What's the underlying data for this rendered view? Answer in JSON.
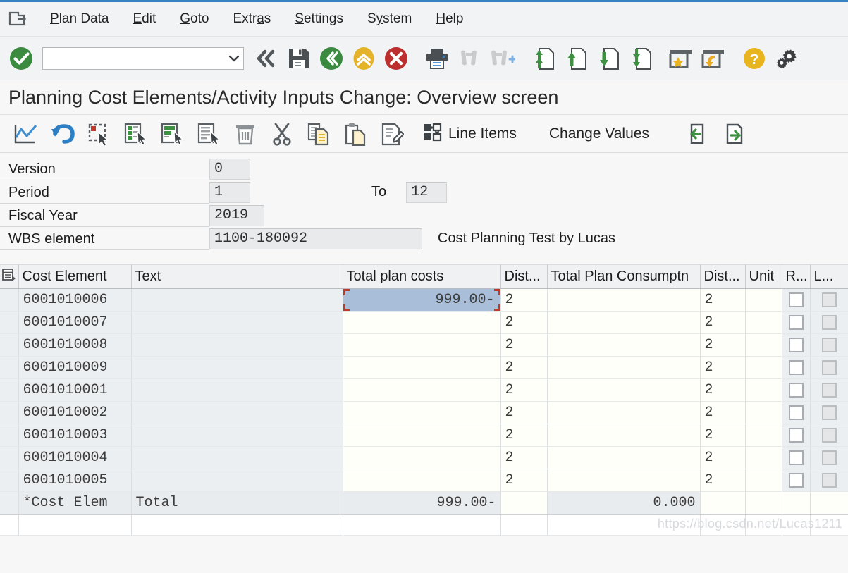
{
  "window": {
    "title": "Planning Cost Elements/Activity Inputs Change: Overview screen"
  },
  "menubar": {
    "system_icon": "sap-session-icon",
    "items": [
      {
        "label": "Plan Data",
        "accel": "P"
      },
      {
        "label": "Edit",
        "accel": "E"
      },
      {
        "label": "Goto",
        "accel": "G"
      },
      {
        "label": "Extras",
        "accel": "a"
      },
      {
        "label": "Settings",
        "accel": "S"
      },
      {
        "label": "System",
        "accel": "y"
      },
      {
        "label": "Help",
        "accel": "H"
      }
    ]
  },
  "system_toolbar": {
    "enter_icon": "green-check-icon",
    "command_field": {
      "value": "",
      "placeholder": ""
    },
    "buttons": [
      {
        "name": "back-chevrons-icon",
        "title": "Back"
      },
      {
        "name": "save-icon",
        "title": "Save"
      },
      {
        "name": "back-green-icon",
        "title": "Back"
      },
      {
        "name": "exit-yellow-icon",
        "title": "Exit"
      },
      {
        "name": "cancel-red-icon",
        "title": "Cancel"
      },
      {
        "name": "print-icon",
        "title": "Print"
      },
      {
        "name": "find-icon",
        "title": "Find",
        "disabled": true
      },
      {
        "name": "find-next-icon",
        "title": "Find Next",
        "disabled": true
      },
      {
        "name": "first-page-icon",
        "title": "First Page"
      },
      {
        "name": "previous-page-icon",
        "title": "Previous Page"
      },
      {
        "name": "next-page-icon",
        "title": "Next Page"
      },
      {
        "name": "last-page-icon",
        "title": "Last Page"
      },
      {
        "name": "create-session-icon",
        "title": "Create New Session"
      },
      {
        "name": "create-shortcut-icon",
        "title": "Create Shortcut"
      },
      {
        "name": "help-icon",
        "title": "Help"
      },
      {
        "name": "customize-layout-icon",
        "title": "Customize Local Layout"
      }
    ]
  },
  "app_toolbar": {
    "icon_buttons": [
      {
        "name": "trend-chart-icon",
        "title": "Planner Profile"
      },
      {
        "name": "undo-icon",
        "title": "Undo"
      },
      {
        "name": "select-block-icon",
        "title": "Select Block"
      },
      {
        "name": "select-column-icon",
        "title": "Select Column"
      },
      {
        "name": "select-row-icon",
        "title": "Select Row"
      },
      {
        "name": "deselect-icon",
        "title": "Deselect"
      },
      {
        "name": "delete-icon",
        "title": "Delete"
      },
      {
        "name": "cut-icon",
        "title": "Cut"
      },
      {
        "name": "copy-icon",
        "title": "Copy"
      },
      {
        "name": "paste-icon",
        "title": "Paste"
      },
      {
        "name": "edit-detail-icon",
        "title": "Period Screen"
      }
    ],
    "line_items": {
      "icon": "puzzle-icon",
      "label": "Line Items"
    },
    "change_values": {
      "label": "Change Values"
    },
    "nav_buttons": [
      {
        "name": "previous-screen-icon",
        "title": "Previous Screen"
      },
      {
        "name": "next-screen-icon",
        "title": "Next Screen"
      }
    ]
  },
  "form": {
    "version": {
      "label": "Version",
      "value": "0"
    },
    "period": {
      "label": "Period",
      "value": "1"
    },
    "to": {
      "label": "To",
      "value": "12"
    },
    "fiscal_year": {
      "label": "Fiscal Year",
      "value": "2019"
    },
    "wbs_element": {
      "label": "WBS element",
      "value": "1100-180092",
      "description": "Cost Planning Test by Lucas"
    }
  },
  "table": {
    "config_icon": "table-settings-icon",
    "columns": [
      {
        "key": "cost_element",
        "label": "Cost Element"
      },
      {
        "key": "text",
        "label": "Text"
      },
      {
        "key": "total_plan_costs",
        "label": "Total plan costs"
      },
      {
        "key": "dist1",
        "label": "Dist..."
      },
      {
        "key": "total_plan_consumptn",
        "label": "Total Plan Consumptn"
      },
      {
        "key": "dist2",
        "label": "Dist..."
      },
      {
        "key": "unit",
        "label": "Unit"
      },
      {
        "key": "r_col",
        "label": "R..."
      },
      {
        "key": "l_col",
        "label": "L..."
      }
    ],
    "rows": [
      {
        "cost_element": "6001010006",
        "text": "",
        "total_plan_costs": "999.00-",
        "dist1": "2",
        "total_plan_consumptn": "",
        "dist2": "2",
        "unit": "",
        "r_checked": false,
        "l_checked": false,
        "selected": true
      },
      {
        "cost_element": "6001010007",
        "text": "",
        "total_plan_costs": "",
        "dist1": "2",
        "total_plan_consumptn": "",
        "dist2": "2",
        "unit": "",
        "r_checked": false,
        "l_checked": false,
        "selected": false
      },
      {
        "cost_element": "6001010008",
        "text": "",
        "total_plan_costs": "",
        "dist1": "2",
        "total_plan_consumptn": "",
        "dist2": "2",
        "unit": "",
        "r_checked": false,
        "l_checked": false,
        "selected": false
      },
      {
        "cost_element": "6001010009",
        "text": "",
        "total_plan_costs": "",
        "dist1": "2",
        "total_plan_consumptn": "",
        "dist2": "2",
        "unit": "",
        "r_checked": false,
        "l_checked": false,
        "selected": false
      },
      {
        "cost_element": "6001010001",
        "text": "",
        "total_plan_costs": "",
        "dist1": "2",
        "total_plan_consumptn": "",
        "dist2": "2",
        "unit": "",
        "r_checked": false,
        "l_checked": false,
        "selected": false
      },
      {
        "cost_element": "6001010002",
        "text": "",
        "total_plan_costs": "",
        "dist1": "2",
        "total_plan_consumptn": "",
        "dist2": "2",
        "unit": "",
        "r_checked": false,
        "l_checked": false,
        "selected": false
      },
      {
        "cost_element": "6001010003",
        "text": "",
        "total_plan_costs": "",
        "dist1": "2",
        "total_plan_consumptn": "",
        "dist2": "2",
        "unit": "",
        "r_checked": false,
        "l_checked": false,
        "selected": false
      },
      {
        "cost_element": "6001010004",
        "text": "",
        "total_plan_costs": "",
        "dist1": "2",
        "total_plan_consumptn": "",
        "dist2": "2",
        "unit": "",
        "r_checked": false,
        "l_checked": false,
        "selected": false
      },
      {
        "cost_element": "6001010005",
        "text": "",
        "total_plan_costs": "",
        "dist1": "2",
        "total_plan_consumptn": "",
        "dist2": "2",
        "unit": "",
        "r_checked": false,
        "l_checked": false,
        "selected": false
      }
    ],
    "total_row": {
      "cost_element": "*Cost Elem",
      "text": "Total",
      "total_plan_costs": "999.00-",
      "dist1": "",
      "total_plan_consumptn": "0.000",
      "dist2": "",
      "unit": ""
    }
  },
  "watermark": {
    "text": "https://blog.csdn.net/Lucas1211"
  },
  "colors": {
    "accent": "#3b7fc4",
    "selection": "#a9bed8",
    "focus_marker": "#c0392b",
    "ok_green": "#2e8b3d",
    "warn_yellow": "#e8b51f",
    "error_red": "#c0392b"
  }
}
